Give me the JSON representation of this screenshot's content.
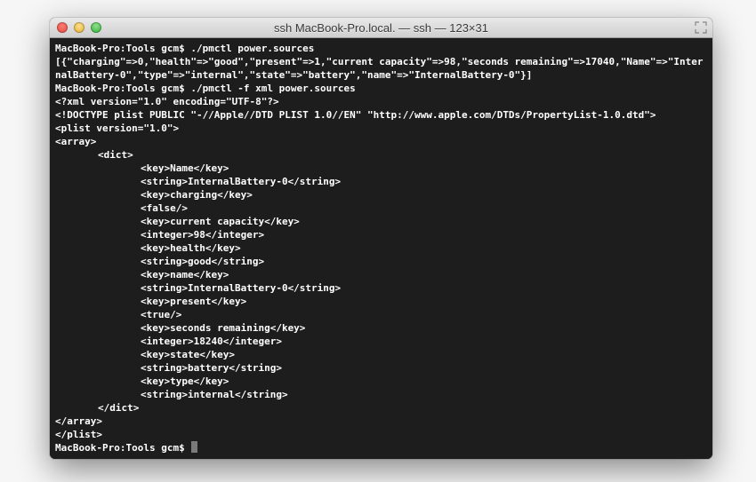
{
  "window": {
    "title": "ssh MacBook-Pro.local. — ssh — 123×31"
  },
  "prompt": {
    "host_path": "MacBook-Pro:Tools gcm$ "
  },
  "cmd1": "./pmctl power.sources",
  "out1": "[{\"charging\"=>0,\"health\"=>\"good\",\"present\"=>1,\"current capacity\"=>98,\"seconds remaining\"=>17040,\"Name\"=>\"InternalBattery-0\",\"type\"=>\"internal\",\"state\"=>\"battery\",\"name\"=>\"InternalBattery-0\"}]",
  "cmd2": "./pmctl -f xml power.sources",
  "xml": {
    "decl": "<?xml version=\"1.0\" encoding=\"UTF-8\"?>",
    "doctype": "<!DOCTYPE plist PUBLIC \"-//Apple//DTD PLIST 1.0//EN\" \"http://www.apple.com/DTDs/PropertyList-1.0.dtd\">",
    "plist_open": "<plist version=\"1.0\">",
    "array_open": "<array>",
    "dict_open": "<dict>",
    "lines": [
      "<key>Name</key>",
      "<string>InternalBattery-0</string>",
      "<key>charging</key>",
      "<false/>",
      "<key>current capacity</key>",
      "<integer>98</integer>",
      "<key>health</key>",
      "<string>good</string>",
      "<key>name</key>",
      "<string>InternalBattery-0</string>",
      "<key>present</key>",
      "<true/>",
      "<key>seconds remaining</key>",
      "<integer>18240</integer>",
      "<key>state</key>",
      "<string>battery</string>",
      "<key>type</key>",
      "<string>internal</string>"
    ],
    "dict_close": "</dict>",
    "array_close": "</array>",
    "plist_close": "</plist>"
  }
}
